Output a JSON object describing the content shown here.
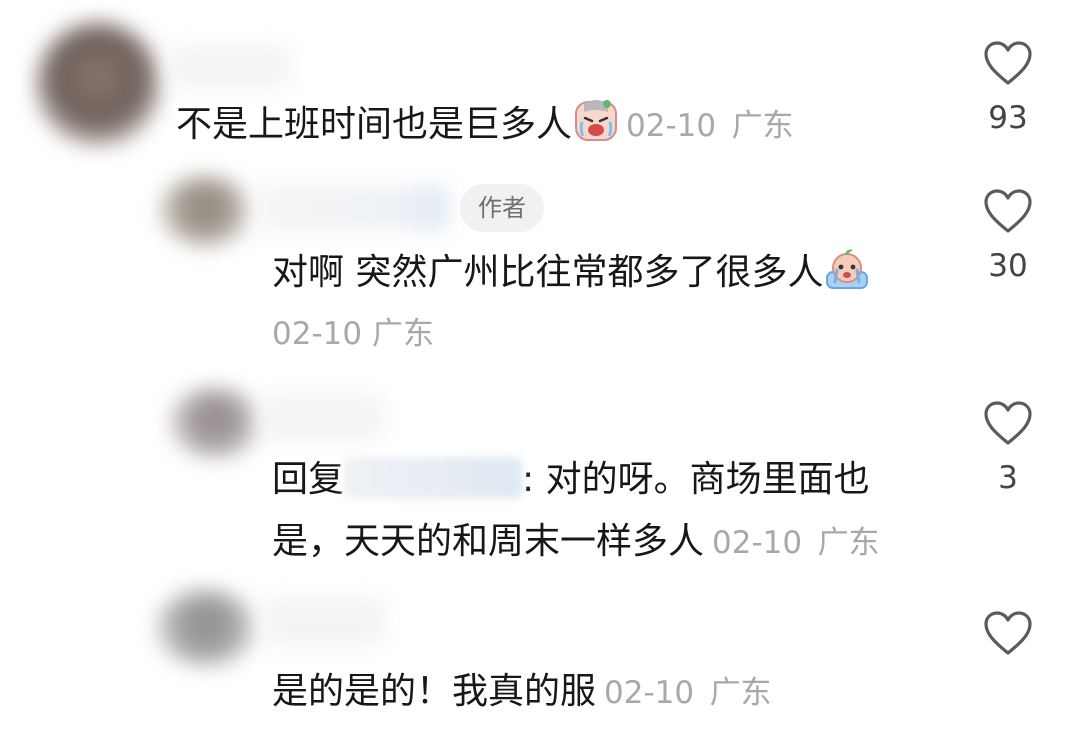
{
  "comments": [
    {
      "text": "不是上班时间也是巨多人",
      "emoji": "crying-face-emoji",
      "date": "02-10",
      "location": "广东",
      "likes": "93"
    },
    {
      "author_tag": "作者",
      "text": "对啊 突然广州比往常都多了很多人",
      "emoji": "crying-peach-emoji",
      "date": "02-10",
      "location": "广东",
      "likes": "30"
    },
    {
      "reply_prefix": "回复",
      "text_line1": ": 对的呀。商场里面也",
      "text_line2": "是，天天的和周末一样多人",
      "date": "02-10",
      "location": "广东",
      "likes": "3"
    },
    {
      "text": "是的是的！我真的服",
      "date": "02-10",
      "location": "广东",
      "likes": ""
    }
  ],
  "colors": {
    "text": "#171717",
    "meta": "#a8a8a8",
    "like_count": "#444444",
    "author_tag_bg": "#f1f1f1"
  }
}
